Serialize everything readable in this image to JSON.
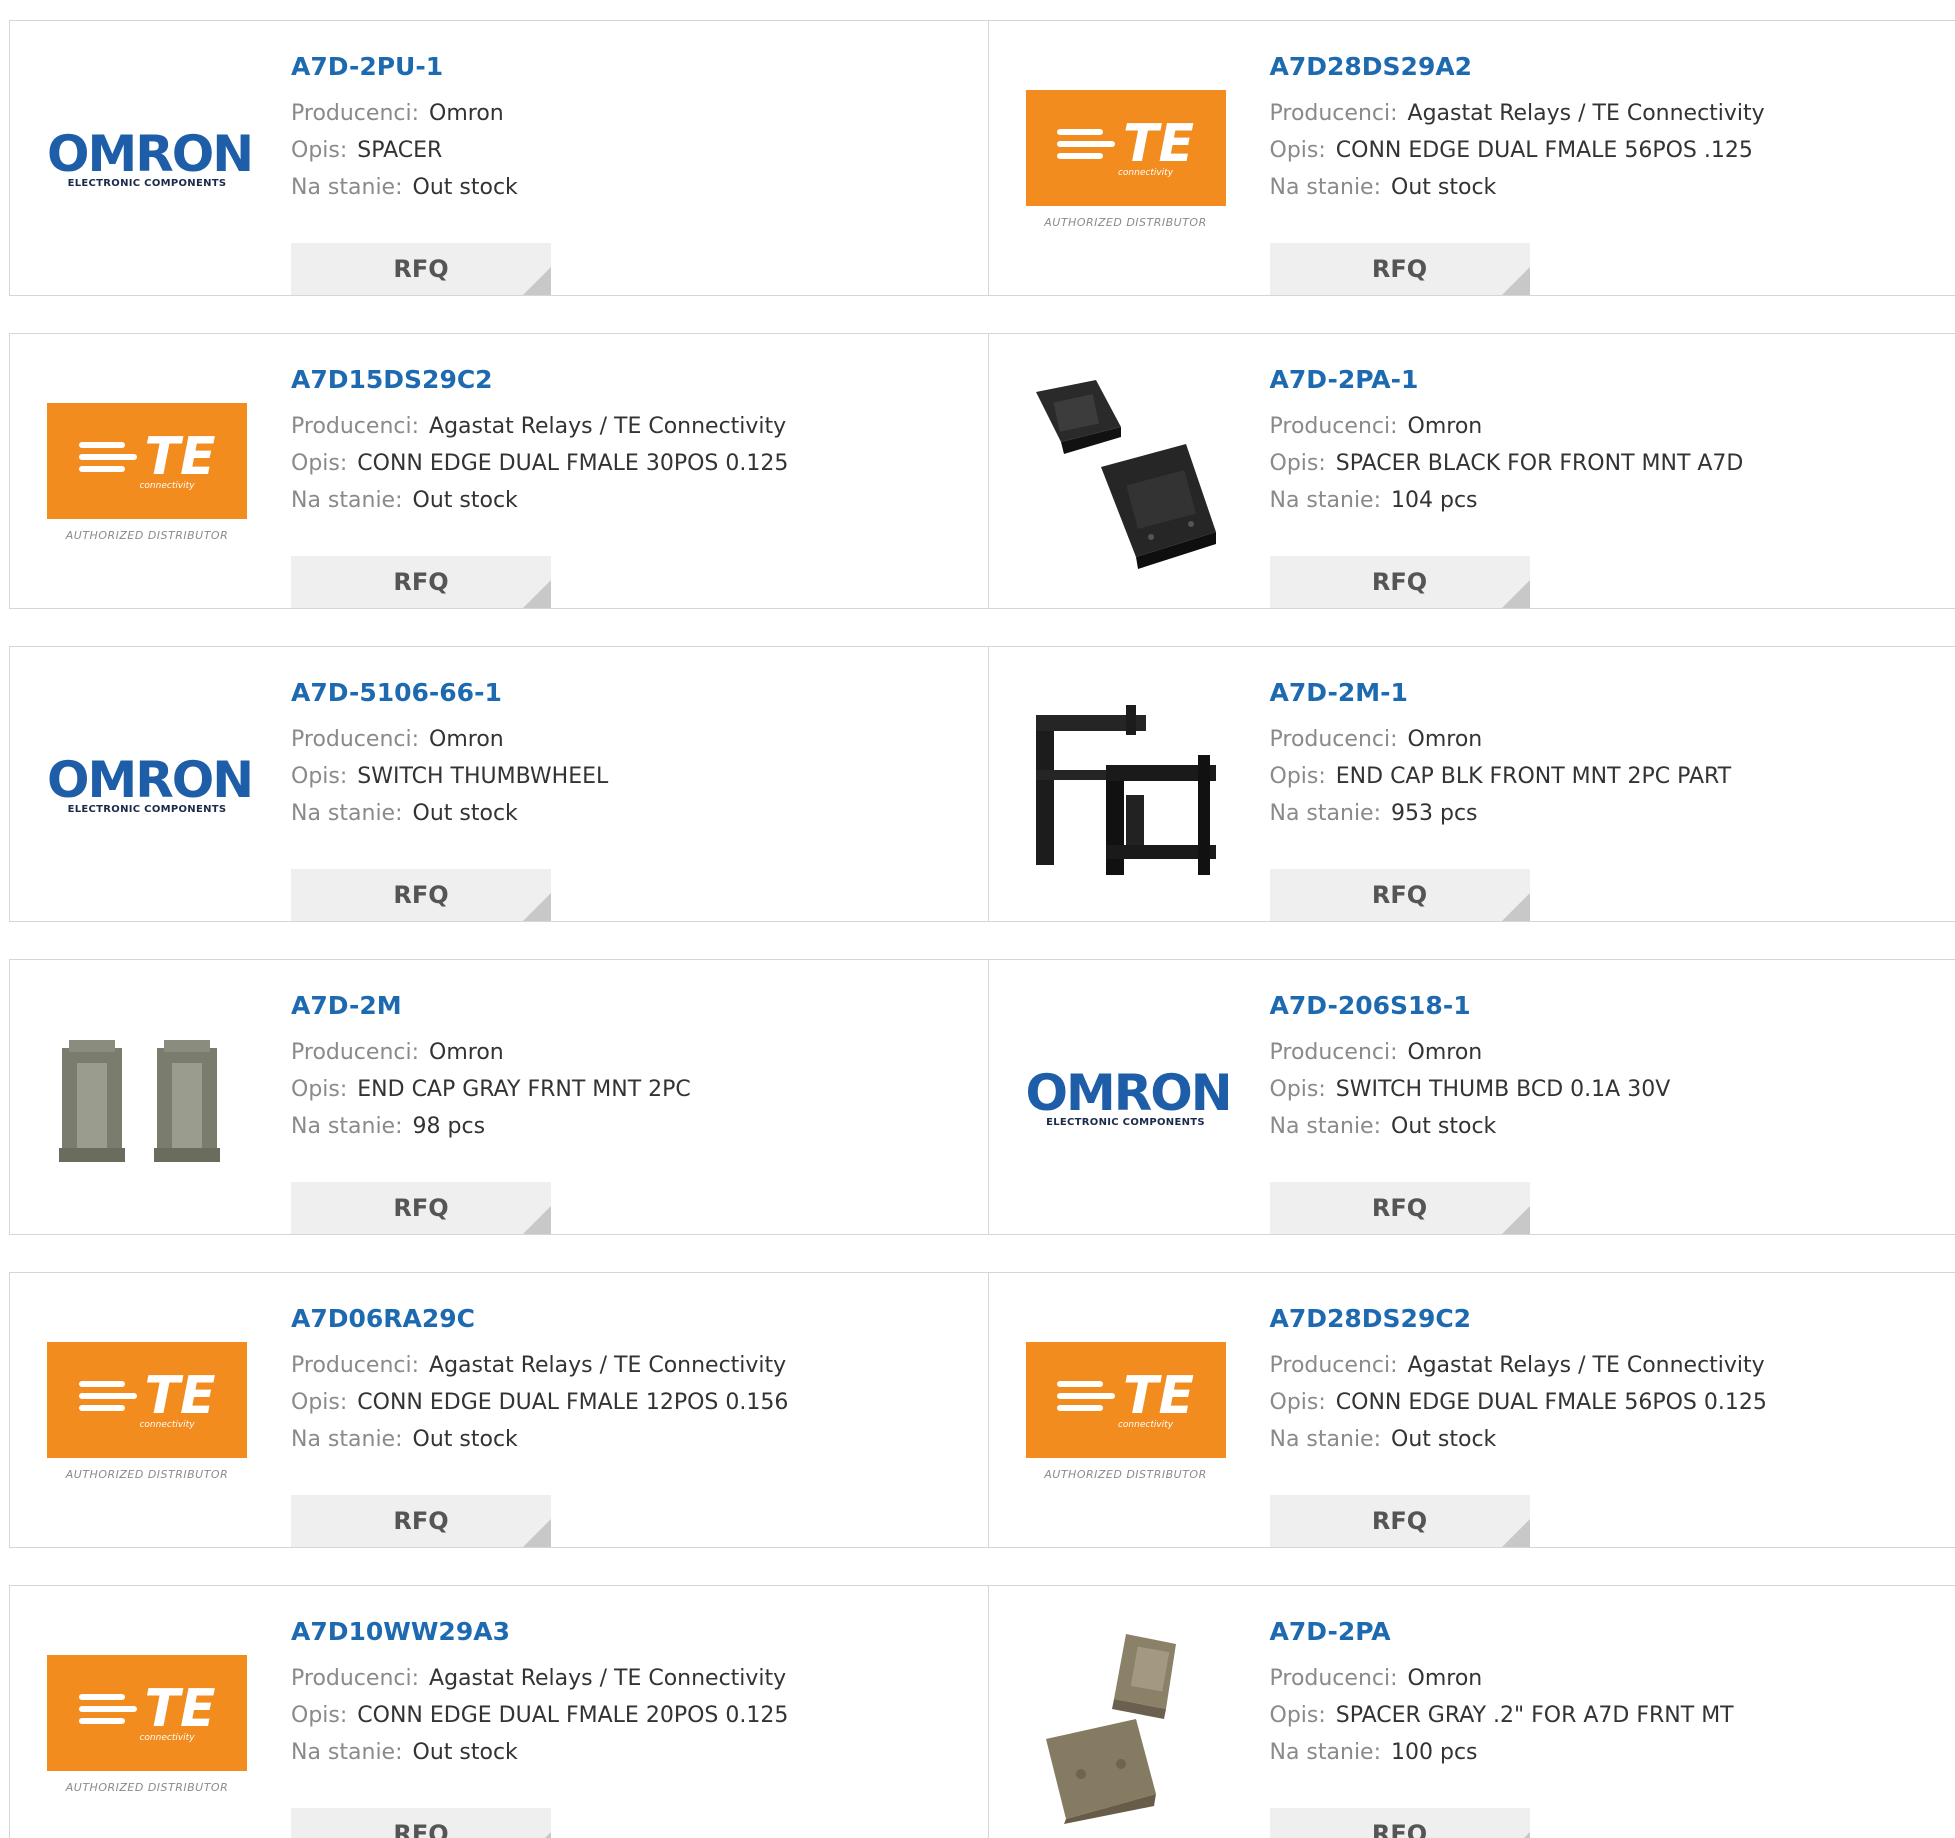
{
  "labels": {
    "manufacturer": "Producenci:",
    "description": "Opis:",
    "stock": "Na stanie:",
    "rfq": "RFQ"
  },
  "logos": {
    "omron_word": "OMRON",
    "omron_sub": "ELECTRONIC COMPONENTS",
    "te_word": "TE",
    "te_sub": "connectivity",
    "te_auth": "AUTHORIZED DISTRIBUTOR"
  },
  "products": [
    {
      "part": "A7D-2PU-1",
      "manufacturer": "Omron",
      "description": "SPACER",
      "stock": "Out stock",
      "image": "omron-logo"
    },
    {
      "part": "A7D28DS29A2",
      "manufacturer": "Agastat Relays / TE Connectivity",
      "description": "CONN EDGE DUAL FMALE 56POS .125",
      "stock": "Out stock",
      "image": "te-logo"
    },
    {
      "part": "A7D15DS29C2",
      "manufacturer": "Agastat Relays / TE Connectivity",
      "description": "CONN EDGE DUAL FMALE 30POS 0.125",
      "stock": "Out stock",
      "image": "te-logo"
    },
    {
      "part": "A7D-2PA-1",
      "manufacturer": "Omron",
      "description": "SPACER BLACK FOR FRONT MNT A7D",
      "stock": "104 pcs",
      "image": "spacer-black-photo"
    },
    {
      "part": "A7D-5106-66-1",
      "manufacturer": "Omron",
      "description": "SWITCH THUMBWHEEL",
      "stock": "Out stock",
      "image": "omron-logo"
    },
    {
      "part": "A7D-2M-1",
      "manufacturer": "Omron",
      "description": "END CAP BLK FRONT MNT 2PC PART",
      "stock": "953 pcs",
      "image": "end-cap-black-photo"
    },
    {
      "part": "A7D-2M",
      "manufacturer": "Omron",
      "description": "END CAP GRAY FRNT MNT 2PC",
      "stock": "98 pcs",
      "image": "end-cap-gray-photo"
    },
    {
      "part": "A7D-206S18-1",
      "manufacturer": "Omron",
      "description": "SWITCH THUMB BCD 0.1A 30V",
      "stock": "Out stock",
      "image": "omron-logo"
    },
    {
      "part": "A7D06RA29C",
      "manufacturer": "Agastat Relays / TE Connectivity",
      "description": "CONN EDGE DUAL FMALE 12POS 0.156",
      "stock": "Out stock",
      "image": "te-logo"
    },
    {
      "part": "A7D28DS29C2",
      "manufacturer": "Agastat Relays / TE Connectivity",
      "description": "CONN EDGE DUAL FMALE 56POS 0.125",
      "stock": "Out stock",
      "image": "te-logo"
    },
    {
      "part": "A7D10WW29A3",
      "manufacturer": "Agastat Relays / TE Connectivity",
      "description": "CONN EDGE DUAL FMALE 20POS 0.125",
      "stock": "Out stock",
      "image": "te-logo"
    },
    {
      "part": "A7D-2PA",
      "manufacturer": "Omron",
      "description": "SPACER GRAY .2\" FOR A7D FRNT MT",
      "stock": "100 pcs",
      "image": "spacer-gray-photo"
    }
  ],
  "colors": {
    "part_link": "#1e6ab0",
    "label": "#8a8a8a",
    "omron_blue": "#1e5ea8",
    "te_orange": "#f28c1e",
    "rfq_bg": "#efefef"
  }
}
